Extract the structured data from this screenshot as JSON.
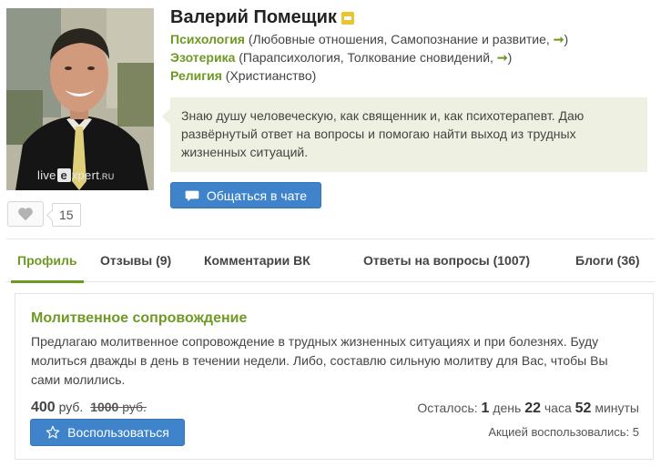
{
  "profile": {
    "name": "Валерий Помещик",
    "watermark": {
      "prefix": "live",
      "e": "e",
      "suffix": "xpert",
      "tld": ".RU"
    },
    "likes": "15",
    "categories": [
      {
        "name": "Психология",
        "detail": " (Любовные отношения, Самопознание и развитие, ",
        "arrow": "➞",
        "close": ")"
      },
      {
        "name": "Эзотерика",
        "detail": " (Парапсихология, Толкование сновидений, ",
        "arrow": "➞",
        "close": ")"
      },
      {
        "name": "Религия",
        "detail": " (Христианство)"
      }
    ],
    "bio": "Знаю душу человеческую, как священник и, как психотерапевт. Даю развёрнутый ответ на вопросы и помогаю найти выход из трудных жизненных ситуаций.",
    "chat_button": "Общаться в чате"
  },
  "tabs": [
    {
      "label": "Профиль",
      "active": true
    },
    {
      "label": "Отзывы (9)"
    },
    {
      "label": "Комментарии ВК"
    },
    {
      "label": "Ответы на вопросы (1007)"
    },
    {
      "label": "Блоги (36)"
    }
  ],
  "offer": {
    "title": "Молитвенное сопровождение",
    "description": "Предлагаю молитвенное сопровождение в трудных жизненных ситуациях и при болезнях. Буду молиться дважды в день в течении недели. Либо, составлю сильную молитву для Вас, чтобы Вы сами молились.",
    "price": "400",
    "currency": "руб.",
    "old_price": "1000",
    "old_currency": "руб.",
    "use_button": "Воспользоваться",
    "remaining_label": "Осталось:",
    "days": "1",
    "days_label": "день",
    "hours": "22",
    "hours_label": "часа",
    "minutes": "52",
    "minutes_label": "минуты",
    "used_label": "Акцией воспользовались:",
    "used_count": "5"
  },
  "colors": {
    "accent_green": "#6e9a23",
    "button_blue": "#3f84cb",
    "bubble_bg": "#eef1e1"
  }
}
